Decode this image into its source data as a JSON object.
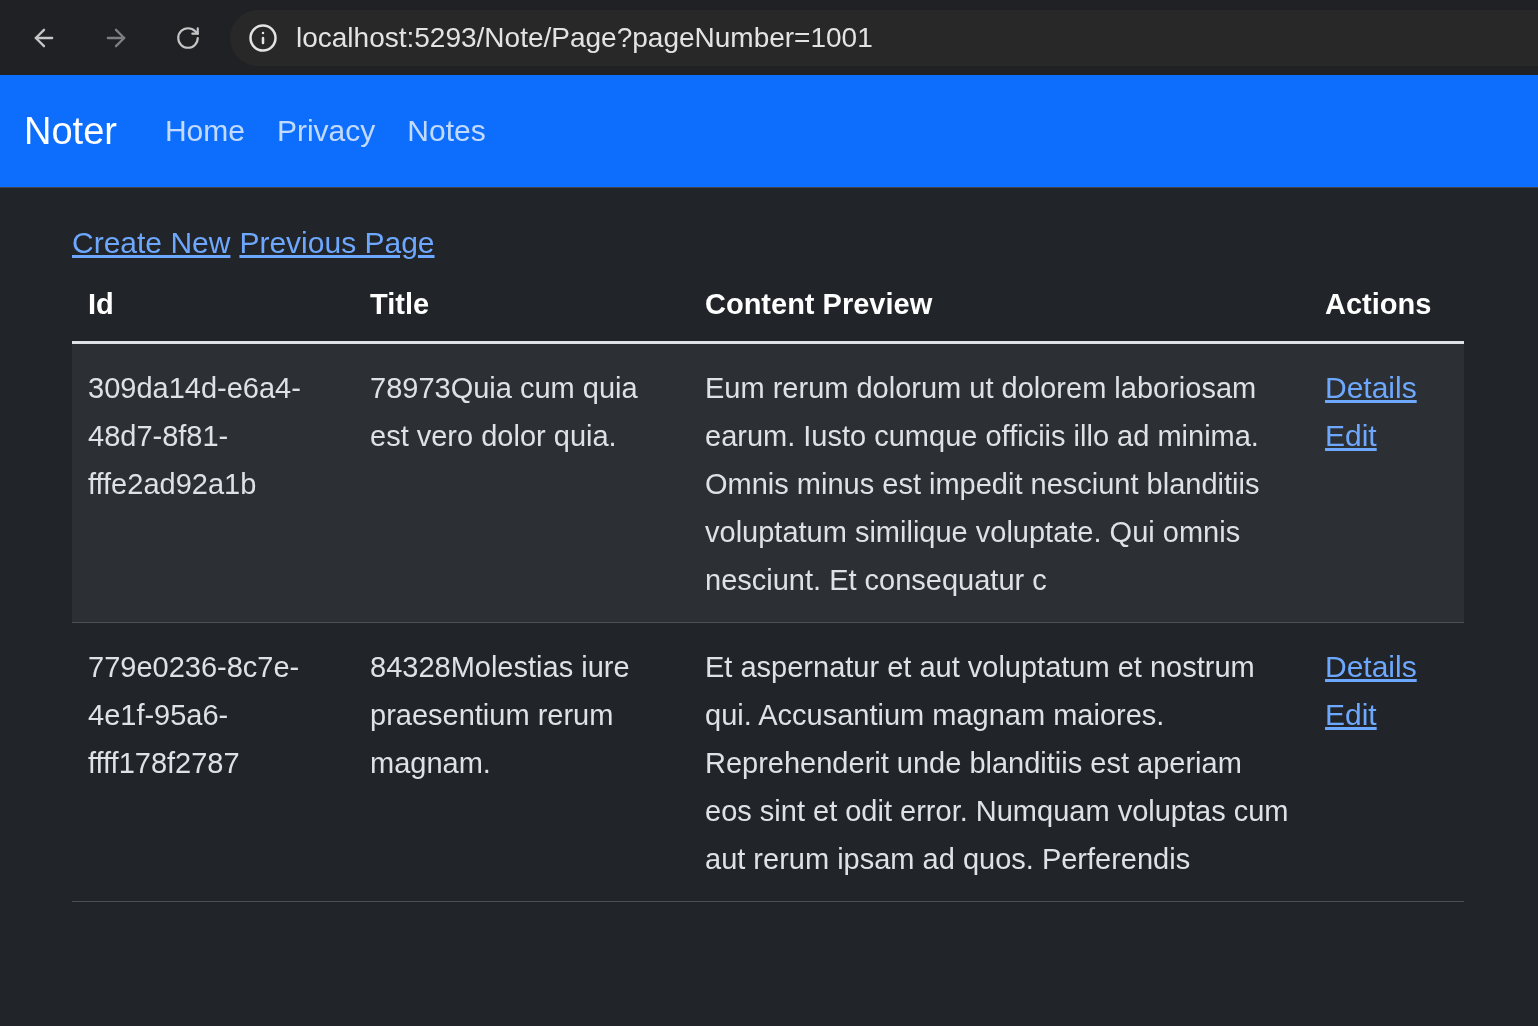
{
  "browser": {
    "url": "localhost:5293/Note/Page?pageNumber=1001"
  },
  "navbar": {
    "brand": "Noter",
    "links": [
      "Home",
      "Privacy",
      "Notes"
    ]
  },
  "page_links": [
    "Create New",
    "Previous Page"
  ],
  "table": {
    "columns": [
      "Id",
      "Title",
      "Content Preview",
      "Actions"
    ],
    "rows": [
      {
        "id": "309da14d-e6a4-48d7-8f81-fffe2ad92a1b",
        "title": "78973Quia cum quia est vero dolor quia.",
        "content": "Eum rerum dolorum ut dolorem laboriosam earum. Iusto cumque officiis illo ad minima. Omnis minus est impedit nesciunt blanditiis voluptatum similique voluptate. Qui omnis nesciunt. Et consequatur c",
        "actions": [
          "Details",
          "Edit"
        ]
      },
      {
        "id": "779e0236-8c7e-4e1f-95a6-ffff178f2787",
        "title": "84328Molestias iure praesentium rerum magnam.",
        "content": "Et aspernatur et aut voluptatum et nostrum qui. Accusantium magnam maiores. Reprehenderit unde blanditiis est aperiam eos sint et odit error. Numquam voluptas cum aut rerum ipsam ad quos. Perferendis",
        "actions": [
          "Details",
          "Edit"
        ]
      }
    ]
  }
}
